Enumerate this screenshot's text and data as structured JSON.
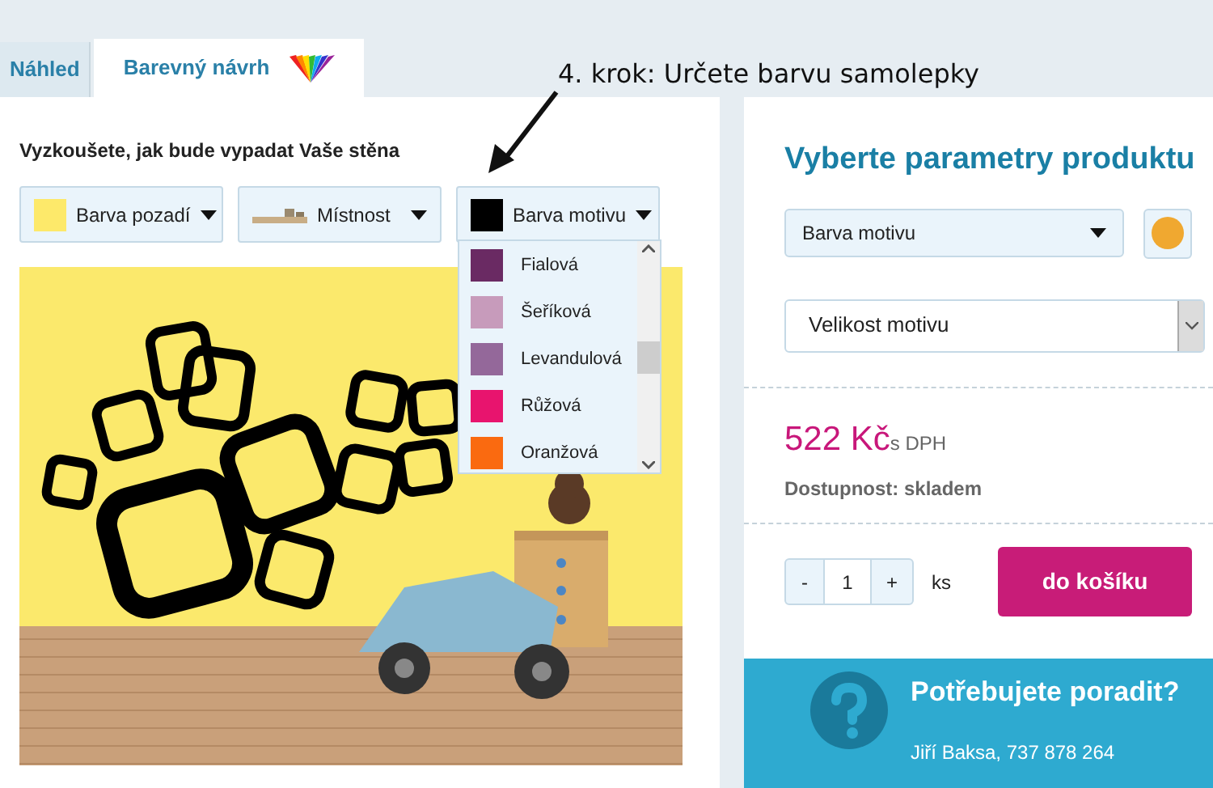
{
  "tabs": [
    {
      "label": "Náhled",
      "selected": false
    },
    {
      "label": "Barevný návrh",
      "selected": true
    }
  ],
  "annotation": "4. krok: Určete barvu samolepky",
  "designer": {
    "heading": "Vyzkoušete, jak bude vypadat Vaše stěna",
    "controls": [
      {
        "kind": "color",
        "label": "Barva pozadí",
        "color": "#fde96a"
      },
      {
        "kind": "room",
        "label": "Místnost"
      },
      {
        "kind": "color",
        "label": "Barva motivu",
        "color": "#000000"
      }
    ],
    "color_options": [
      {
        "label": "Fialová",
        "color": "#6a2a63"
      },
      {
        "label": "Šeříková",
        "color": "#c79bbb"
      },
      {
        "label": "Levandulová",
        "color": "#94689a"
      },
      {
        "label": "Růžová",
        "color": "#e8146e"
      },
      {
        "label": "Oranžová",
        "color": "#fa6a10"
      }
    ]
  },
  "product": {
    "title": "Vyberte parametry produktu",
    "motif_color_select": {
      "label": "Barva motivu",
      "color": "#f0a830"
    },
    "size_select": {
      "label": "Velikost motivu"
    },
    "price": "522 Kč",
    "price_suffix": "s DPH",
    "availability": "Dostupnost: skladem",
    "quantity": {
      "minus": "-",
      "value": "1",
      "plus": "+",
      "unit": "ks"
    },
    "cart_button": "do košíku"
  },
  "help": {
    "title": "Potřebujete poradit?",
    "contact": "Jiří Baksa, 737 878 264"
  }
}
